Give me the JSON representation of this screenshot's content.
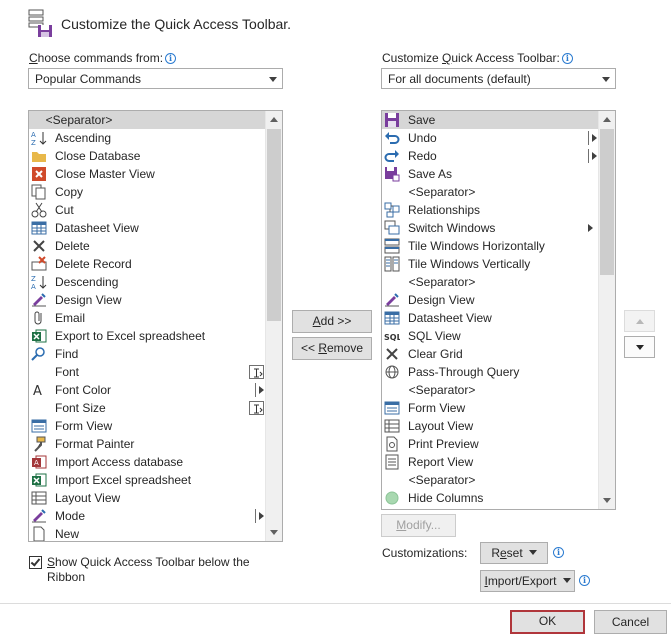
{
  "header": {
    "title": "Customize the Quick Access Toolbar."
  },
  "left": {
    "label_pre": "",
    "label_accel": "C",
    "label_post": "hoose commands from:",
    "dropdown_value": "Popular Commands",
    "items": [
      {
        "label": "<Separator>",
        "icon": "none",
        "separator": true,
        "selected": true
      },
      {
        "label": "Ascending",
        "icon": "sort-ascending-icon"
      },
      {
        "label": "Close Database",
        "icon": "folder-icon"
      },
      {
        "label": "Close Master View",
        "icon": "close-red-icon"
      },
      {
        "label": "Copy",
        "icon": "copy-icon"
      },
      {
        "label": "Cut",
        "icon": "scissors-icon"
      },
      {
        "label": "Datasheet View",
        "icon": "datasheet-icon"
      },
      {
        "label": "Delete",
        "icon": "delete-x-icon"
      },
      {
        "label": "Delete Record",
        "icon": "delete-record-icon"
      },
      {
        "label": "Descending",
        "icon": "sort-descending-icon"
      },
      {
        "label": "Design View",
        "icon": "design-view-icon"
      },
      {
        "label": "Email",
        "icon": "attachment-icon"
      },
      {
        "label": "Export to Excel spreadsheet",
        "icon": "excel-icon"
      },
      {
        "label": "Find",
        "icon": "find-icon"
      },
      {
        "label": "Font",
        "icon": "none",
        "control": "box"
      },
      {
        "label": "Font Color",
        "icon": "font-color-icon",
        "control": "arrow"
      },
      {
        "label": "Font Size",
        "icon": "none",
        "control": "box"
      },
      {
        "label": "Form View",
        "icon": "form-view-icon"
      },
      {
        "label": "Format Painter",
        "icon": "format-painter-icon"
      },
      {
        "label": "Import Access database",
        "icon": "access-icon"
      },
      {
        "label": "Import Excel spreadsheet",
        "icon": "excel-icon"
      },
      {
        "label": "Layout View",
        "icon": "layout-view-icon"
      },
      {
        "label": "Mode",
        "icon": "design-view-icon",
        "control": "arrow"
      },
      {
        "label": "New",
        "icon": "new-doc-icon"
      }
    ]
  },
  "right": {
    "label_pre": "Customize ",
    "label_accel": "Q",
    "label_post": "uick Access Toolbar:",
    "dropdown_value": "For all documents (default)",
    "items": [
      {
        "label": "Save",
        "icon": "save-icon",
        "selected": true
      },
      {
        "label": "Undo",
        "icon": "undo-icon",
        "control": "arrow"
      },
      {
        "label": "Redo",
        "icon": "redo-icon",
        "control": "arrow"
      },
      {
        "label": "Save As",
        "icon": "save-as-icon"
      },
      {
        "label": "<Separator>",
        "icon": "none",
        "separator": true
      },
      {
        "label": "Relationships",
        "icon": "relationships-icon"
      },
      {
        "label": "Switch Windows",
        "icon": "switch-windows-icon",
        "control": "arrow-plain"
      },
      {
        "label": "Tile Windows Horizontally",
        "icon": "tile-horizontal-icon"
      },
      {
        "label": "Tile Windows Vertically",
        "icon": "tile-vertical-icon"
      },
      {
        "label": "<Separator>",
        "icon": "none",
        "separator": true
      },
      {
        "label": "Design View",
        "icon": "design-view-icon"
      },
      {
        "label": "Datasheet View",
        "icon": "datasheet-icon"
      },
      {
        "label": "SQL View",
        "icon": "sql-icon"
      },
      {
        "label": "Clear Grid",
        "icon": "delete-x-icon"
      },
      {
        "label": "Pass-Through Query",
        "icon": "globe-icon"
      },
      {
        "label": "<Separator>",
        "icon": "none",
        "separator": true
      },
      {
        "label": "Form View",
        "icon": "form-view-icon"
      },
      {
        "label": "Layout View",
        "icon": "layout-view-icon"
      },
      {
        "label": "Print Preview",
        "icon": "print-preview-icon"
      },
      {
        "label": "Report View",
        "icon": "report-view-icon"
      },
      {
        "label": "<Separator>",
        "icon": "none",
        "separator": true
      },
      {
        "label": "Hide Columns",
        "icon": "hide-columns-icon"
      }
    ]
  },
  "buttons": {
    "add_accel": "A",
    "add_rest": "dd >>",
    "remove_pre": "<< ",
    "remove_accel": "R",
    "remove_rest": "emove",
    "modify_pre": "",
    "modify_accel": "M",
    "modify_rest": "odify...",
    "reset_pre": "R",
    "reset_accel": "e",
    "reset_rest": "set",
    "import_export_pre": "",
    "import_export_accel": "I",
    "import_export_rest": "mport/Export",
    "ok": "OK",
    "cancel": "Cancel"
  },
  "customizations_label": "Customizations:",
  "checkbox": {
    "accel": "S",
    "line1_rest": "how Quick Access Toolbar below the",
    "line2": "Ribbon",
    "checked": true
  },
  "colors": {
    "selected_row": "#d6d6d6",
    "ok_border": "#b0363b",
    "info_blue": "#2b7bd0"
  }
}
